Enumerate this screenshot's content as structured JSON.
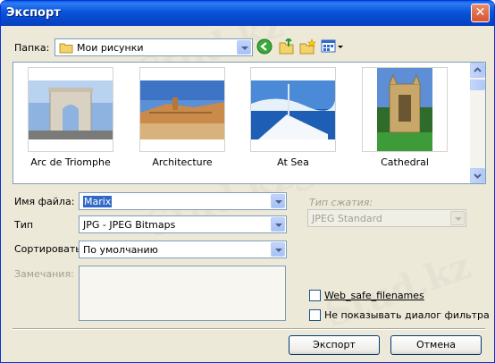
{
  "window": {
    "title": "Экспорт",
    "close_glyph": "✕"
  },
  "folder": {
    "label": "Папка:",
    "value": "Мои рисунки"
  },
  "toolbar_icons": [
    "back-icon",
    "up-folder-icon",
    "new-folder-icon",
    "view-menu-icon"
  ],
  "thumbnails": [
    {
      "caption": "Arc de Triomphe"
    },
    {
      "caption": "Architecture"
    },
    {
      "caption": "At Sea"
    },
    {
      "caption": "Cathedral"
    }
  ],
  "filename": {
    "label": "Имя файла:",
    "value": "Marix"
  },
  "type": {
    "label": "Тип",
    "value": "JPG - JPEG Bitmaps"
  },
  "sort": {
    "label": "Сортировать",
    "value": "По умолчанию"
  },
  "notes": {
    "label": "Замечания:"
  },
  "compression": {
    "label": "Тип сжатия:",
    "value": "JPEG Standard"
  },
  "checkboxes": [
    {
      "label": "Web_safe_filenames",
      "checked": false
    },
    {
      "label": "Не показывать диалог фильтра",
      "checked": false
    }
  ],
  "buttons": {
    "export": "Экспорт",
    "cancel": "Отмена"
  },
  "watermark": "Stud.kz"
}
